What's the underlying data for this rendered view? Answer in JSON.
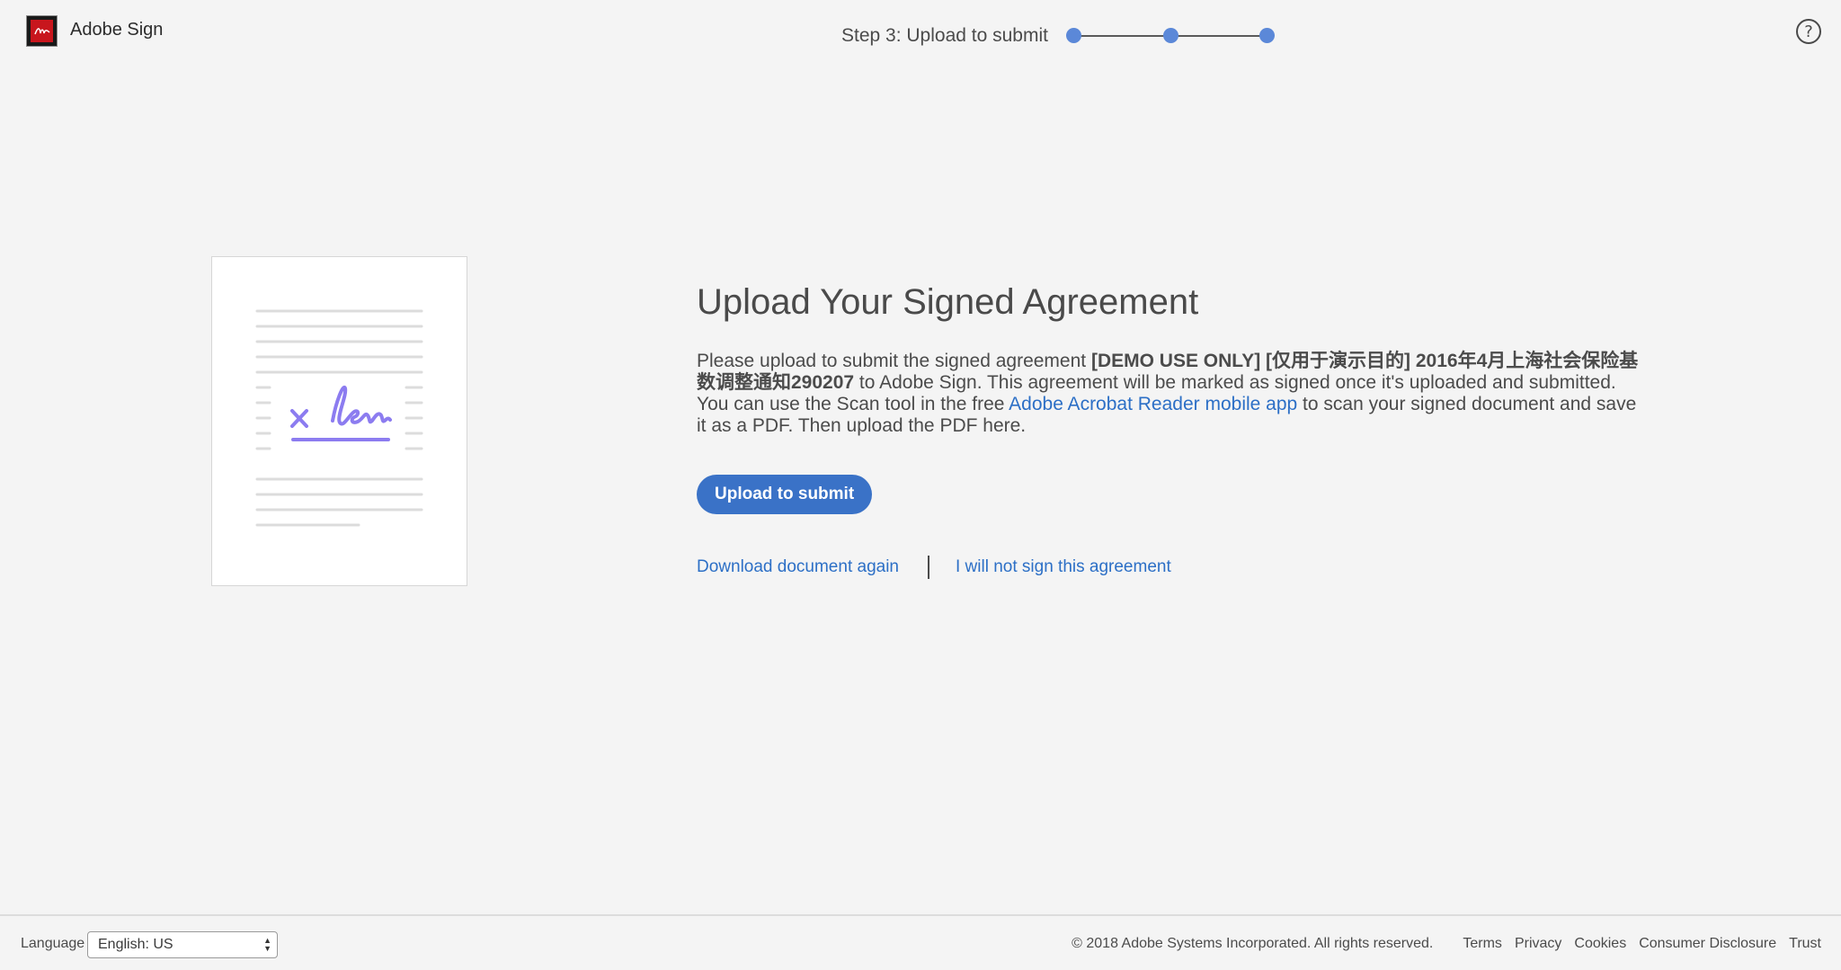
{
  "header": {
    "app_name": "Adobe Sign",
    "step_label": "Step 3: Upload to submit",
    "progress": {
      "current_step": 3,
      "total_steps": 3
    },
    "help_glyph": "?"
  },
  "main": {
    "title": "Upload Your Signed Agreement",
    "description": {
      "intro": "Please upload to submit the signed agreement ",
      "agreement_name": "[DEMO USE ONLY] [仅用于演示目的] 2016年4月上海社会保险基数调整通知290207",
      "after_name": " to Adobe Sign. This agreement will be marked as signed once it's uploaded and submitted. You can use the Scan tool in the free ",
      "reader_link": "Adobe Acrobat Reader mobile app",
      "outro": " to scan your signed document and save it as a PDF. Then upload the PDF here."
    },
    "upload_button": "Upload to submit",
    "download_link": "Download document again",
    "decline_link": "I will not sign this agreement"
  },
  "footer": {
    "language_label": "Language",
    "language_value": "English: US",
    "copyright": "© 2018 Adobe Systems Incorporated. All rights reserved.",
    "links": [
      "Terms",
      "Privacy",
      "Cookies",
      "Consumer Disclosure",
      "Trust"
    ]
  },
  "colors": {
    "background": "#f4f4f4",
    "accent": "#3a72c7",
    "link": "#2c6fc6",
    "progress_dot": "#5b88d8",
    "signature": "#8c7cf0"
  },
  "icons": {
    "logo": "adobe-sign-logo",
    "help": "help-circle-icon",
    "illustration": "signed-document-illustration",
    "select_arrows": "select-updown-icon"
  }
}
